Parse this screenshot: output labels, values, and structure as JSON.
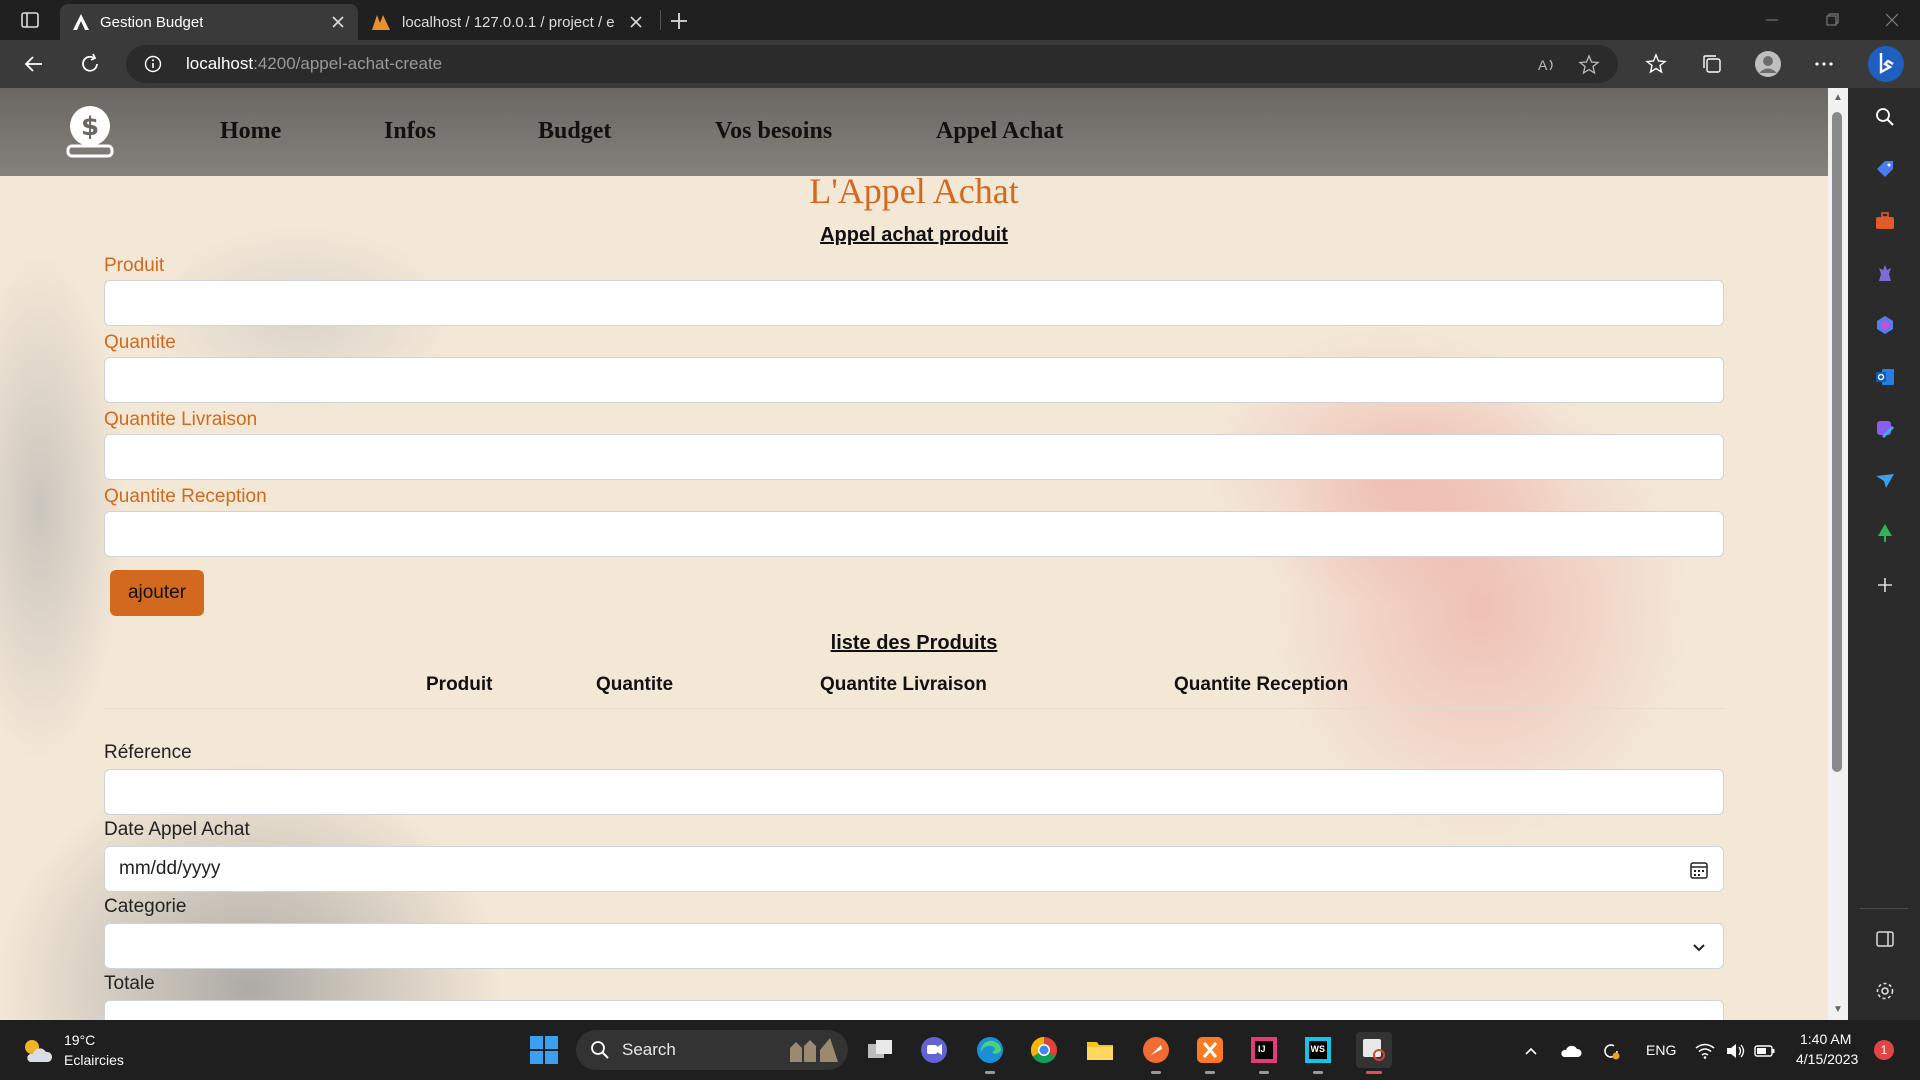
{
  "browser": {
    "tabs": [
      {
        "label": "Gestion Budget",
        "icon": "angular-icon",
        "active": true
      },
      {
        "label": "localhost / 127.0.0.1 / project / e",
        "icon": "phpmyadmin-icon",
        "active": false
      }
    ],
    "address": {
      "host": "localhost",
      "path": ":4200/appel-achat-create"
    }
  },
  "navbar": {
    "logo_icon": "money-bag-icon",
    "items": [
      "Home",
      "Infos",
      "Budget",
      "Vos besoins",
      "Appel Achat"
    ]
  },
  "page": {
    "title": "L'Appel Achat",
    "product_section_title": "Appel achat produit",
    "product_fields": [
      {
        "label": "Produit",
        "value": ""
      },
      {
        "label": "Quantite",
        "value": ""
      },
      {
        "label": "Quantite Livraison",
        "value": ""
      },
      {
        "label": "Quantite Reception",
        "value": ""
      }
    ],
    "add_button": "ajouter",
    "list_title": "liste des Produits",
    "table_headers": [
      "Produit",
      "Quantite",
      "Quantite Livraison",
      "Quantite Reception"
    ],
    "main_fields": {
      "reference_label": "Réference",
      "reference_value": "",
      "date_label": "Date Appel Achat",
      "date_value": "mm/dd/yyyy",
      "categorie_label": "Categorie",
      "categorie_value": "",
      "totale_label": "Totale"
    },
    "colors": {
      "accent": "#d2691e",
      "background": "#f3e7d6",
      "navbar": "#6a6763"
    }
  },
  "taskbar": {
    "weather": {
      "temp": "19°C",
      "condition": "Eclaircies"
    },
    "search_label": "Search",
    "language": "ENG",
    "time": "1:40 AM",
    "date": "4/15/2023",
    "notification_count": "1"
  }
}
